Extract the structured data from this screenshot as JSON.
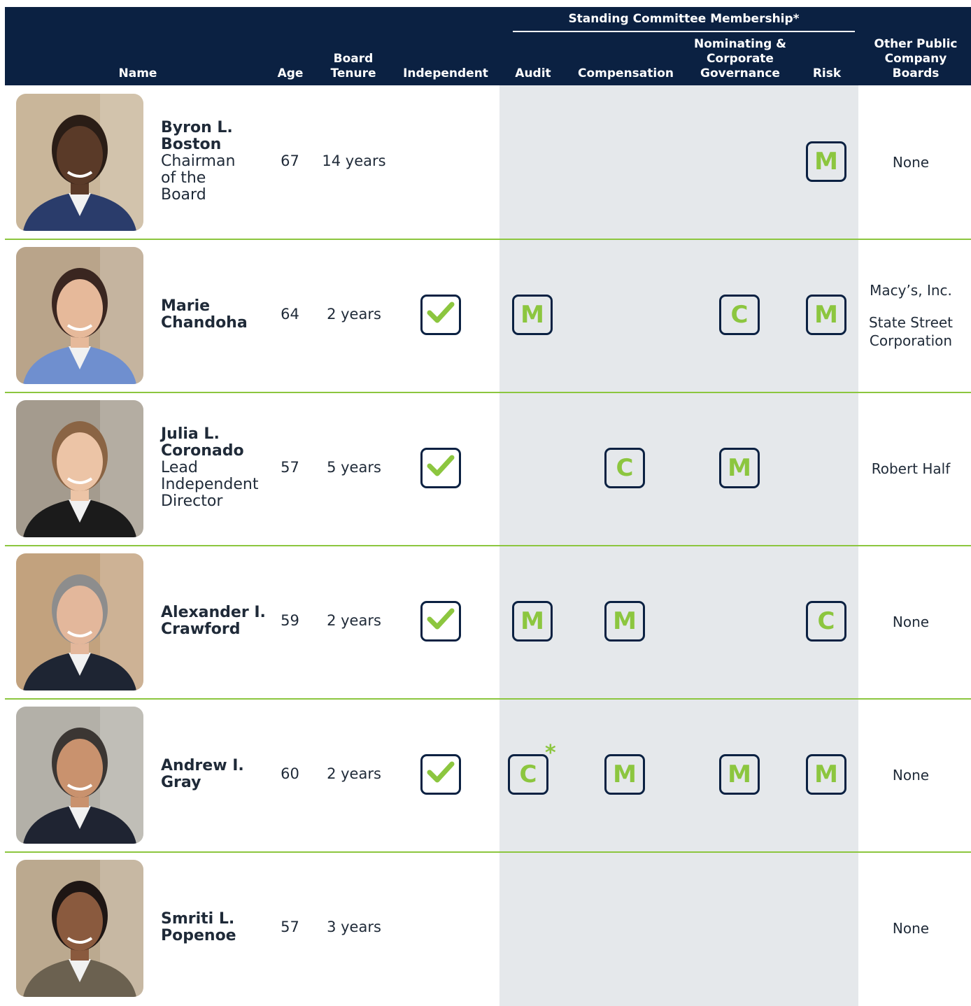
{
  "header": {
    "name": "Name",
    "age": "Age",
    "tenure": "Board\nTenure",
    "independent": "Independent",
    "committee_group": "Standing Committee Membership*",
    "audit": "Audit",
    "compensation": "Compensation",
    "nominating": "Nominating &\nCorporate\nGovernance",
    "risk": "Risk",
    "other_boards": "Other Public\nCompany\nBoards"
  },
  "colors": {
    "navy": "#0b2142",
    "green": "#8cc63f",
    "gray": "#e5e8eb"
  },
  "icons": {
    "independent": "checkmark-icon",
    "photo": "person-photo"
  },
  "directors": [
    {
      "name": "Byron L.\nBoston",
      "role": "Chairman\nof the\nBoard",
      "age": "67",
      "tenure": "14 years",
      "independent": false,
      "audit": "",
      "compensation": "",
      "nominating": "",
      "risk": "M",
      "other_boards": [
        "None"
      ]
    },
    {
      "name": "Marie\nChandoha",
      "role": "",
      "age": "64",
      "tenure": "2 years",
      "independent": true,
      "audit": "M",
      "compensation": "",
      "nominating": "C",
      "risk": "M",
      "other_boards": [
        "Macy’s, Inc.",
        "State Street\nCorporation"
      ]
    },
    {
      "name": "Julia L.\nCoronado",
      "role": "Lead\nIndependent\nDirector",
      "age": "57",
      "tenure": "5 years",
      "independent": true,
      "audit": "",
      "compensation": "C",
      "nominating": "M",
      "risk": "",
      "other_boards": [
        "Robert Half"
      ]
    },
    {
      "name": "Alexander I.\nCrawford",
      "role": "",
      "age": "59",
      "tenure": "2 years",
      "independent": true,
      "audit": "M",
      "compensation": "M",
      "nominating": "",
      "risk": "C",
      "other_boards": [
        "None"
      ]
    },
    {
      "name": "Andrew I.\nGray",
      "role": "",
      "age": "60",
      "tenure": "2 years",
      "independent": true,
      "audit": "C",
      "audit_note": "*",
      "compensation": "M",
      "nominating": "M",
      "risk": "M",
      "other_boards": [
        "None"
      ]
    },
    {
      "name": "Smriti L.\nPopenoe",
      "role": "",
      "age": "57",
      "tenure": "3 years",
      "independent": false,
      "audit": "",
      "compensation": "",
      "nominating": "",
      "risk": "",
      "other_boards": [
        "None"
      ]
    }
  ]
}
